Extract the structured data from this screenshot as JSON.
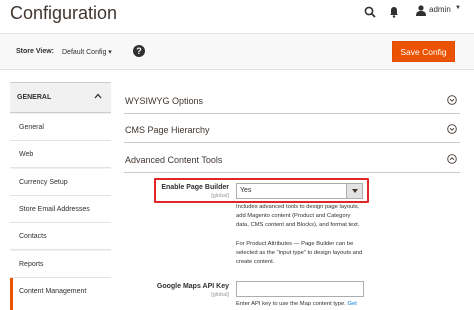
{
  "header": {
    "title": "Configuration",
    "user": "admin",
    "icons": [
      "search-icon",
      "bell-icon",
      "user-icon",
      "caret-down-icon"
    ]
  },
  "toolbar": {
    "store_view_label": "Store View:",
    "store_view_value": "Default Config ▾",
    "help": "?",
    "save_label": "Save Config"
  },
  "sidebar": {
    "group": "GENERAL",
    "items": [
      {
        "label": "General"
      },
      {
        "label": "Web"
      },
      {
        "label": "Currency Setup"
      },
      {
        "label": "Store Email Addresses"
      },
      {
        "label": "Contacts"
      },
      {
        "label": "Reports"
      },
      {
        "label": "Content Management"
      }
    ],
    "active": "Content Management"
  },
  "sections": [
    {
      "title": "WYSIWYG Options",
      "state": "collapsed"
    },
    {
      "title": "CMS Page Hierarchy",
      "state": "collapsed"
    },
    {
      "title": "Advanced Content Tools",
      "state": "expanded"
    }
  ],
  "fields": {
    "page_builder": {
      "label": "Enable Page Builder",
      "scope": "[global]",
      "value": "Yes",
      "note_1": "Includes advanced tools to design page layouts, add Magento content (Product and Category data, CMS content and Blocks), and format text.",
      "note_2": "For Product Attributes — Page Builder can be selected as the \"input type\" to design layouts and create content."
    },
    "maps_key": {
      "label": "Google Maps API Key",
      "scope": "[global]",
      "value": "",
      "note": "Enter API key to use the Map content type.",
      "note_link": "Get"
    }
  },
  "colors": {
    "accent": "#eb5202",
    "highlight": "#e22626",
    "link": "#007bdb"
  }
}
